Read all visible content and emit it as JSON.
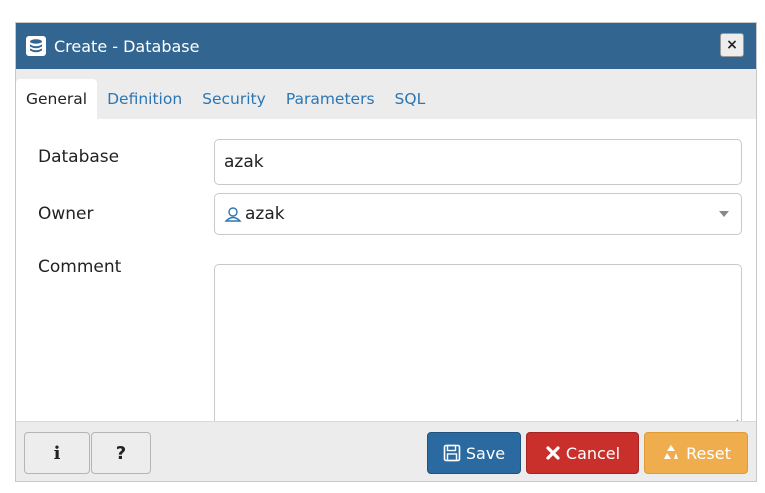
{
  "dialog": {
    "title": "Create - Database",
    "title_icon": "database-icon",
    "close_label": "×",
    "colors": {
      "titlebar": "#326690",
      "tab_link": "#2c76b4",
      "save": "#2a6aa0",
      "cancel": "#c9302c",
      "reset": "#f0ad4e"
    }
  },
  "tabs": [
    {
      "label": "General",
      "active": true
    },
    {
      "label": "Definition",
      "active": false
    },
    {
      "label": "Security",
      "active": false
    },
    {
      "label": "Parameters",
      "active": false
    },
    {
      "label": "SQL",
      "active": false
    }
  ],
  "form": {
    "database_label": "Database",
    "database_value": "azak",
    "owner_label": "Owner",
    "owner_value": "azak",
    "owner_icon": "user-icon",
    "comment_label": "Comment",
    "comment_value": ""
  },
  "footer": {
    "info_label": "i",
    "help_label": "?",
    "save_label": "Save",
    "cancel_label": "Cancel",
    "reset_label": "Reset"
  }
}
